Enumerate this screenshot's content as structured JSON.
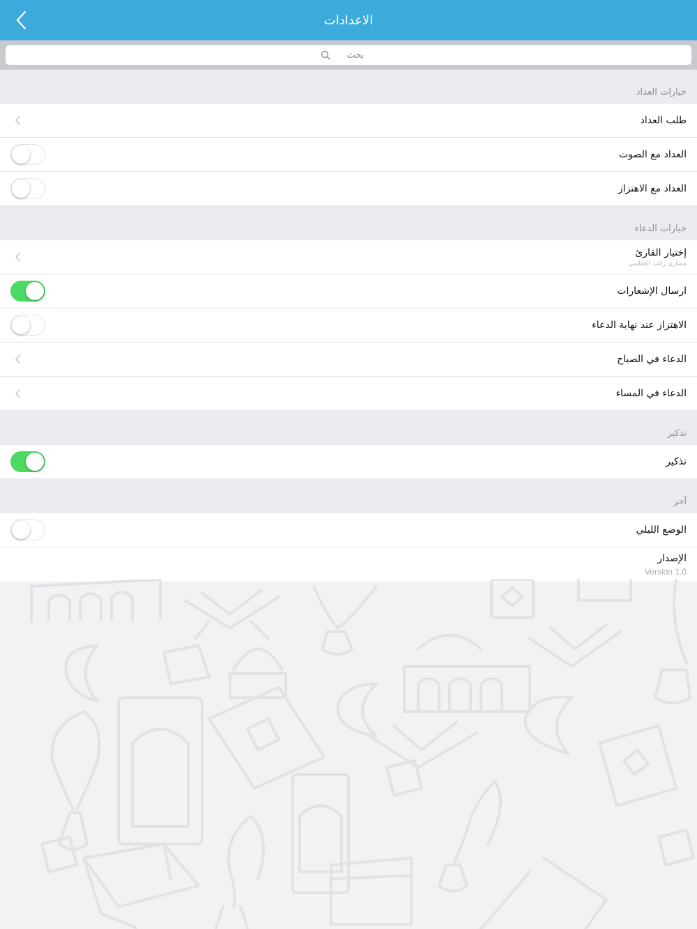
{
  "header": {
    "title": "الاعدادات",
    "back_icon": "chevron-left-icon"
  },
  "search": {
    "placeholder": "بحث"
  },
  "sections": [
    {
      "title": "خيارات العداد",
      "rows": [
        {
          "label": "طلب العداد",
          "type": "nav"
        },
        {
          "label": "العداد مع الصوت",
          "type": "toggle",
          "on": false
        },
        {
          "label": "العداد مع الاهتزاز",
          "type": "toggle",
          "on": false
        }
      ]
    },
    {
      "title": "خيارات الدعاء",
      "rows": [
        {
          "label": "إختيار القارئ",
          "sub": "مشاري راشد العفاسي",
          "type": "nav"
        },
        {
          "label": "ارسال الإشعارات",
          "type": "toggle",
          "on": true
        },
        {
          "label": "الاهتزاز عند نهاية الدعاء",
          "type": "toggle",
          "on": false
        },
        {
          "label": "الدعاء في الصباح",
          "type": "nav"
        },
        {
          "label": "الدعاء في المساء",
          "type": "nav"
        }
      ]
    },
    {
      "title": "تذكير",
      "rows": [
        {
          "label": "تذكير",
          "type": "toggle",
          "on": true
        }
      ]
    },
    {
      "title": "آخر",
      "rows": [
        {
          "label": "الوضع الليلي",
          "type": "toggle",
          "on": false
        },
        {
          "label": "الإصدار",
          "sub": "Version 1.0",
          "type": "info"
        }
      ]
    }
  ],
  "colors": {
    "nav_bar": "#3cabdb",
    "toggle_on": "#4cd964",
    "section_bg": "#ebebf0"
  }
}
